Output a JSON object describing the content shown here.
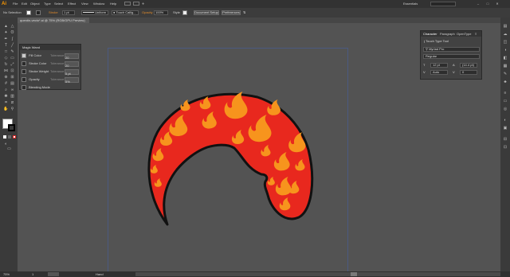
{
  "menubar": {
    "logo": "Ai",
    "items": [
      "File",
      "Edit",
      "Object",
      "Type",
      "Select",
      "Effect",
      "View",
      "Window",
      "Help"
    ],
    "workspace": "Essentials"
  },
  "controlbar": {
    "selection": "No Selection",
    "stroke_label": "Stroke",
    "stroke_weight": "1 pt",
    "stroke_profile": "Uniform",
    "brush": "Touch Callig...",
    "opacity_label": "Opacity",
    "opacity_value": "100%",
    "style_label": "Style",
    "doc_setup": "Document Setup",
    "preferences": "Preferences"
  },
  "document": {
    "tab_title": "quentin-vecto*.ai @ 75% (RGB/GPU Preview)"
  },
  "magic_wand_panel": {
    "title": "Magic Wand",
    "rows": [
      {
        "label": "Fill Color",
        "tolerance_label": "Tolerance",
        "value": "20",
        "checked": true
      },
      {
        "label": "Stroke Color",
        "tolerance_label": "Tolerance",
        "value": "20",
        "checked": false
      },
      {
        "label": "Stroke Weight",
        "tolerance_label": "Tolerance",
        "value": "5 pt",
        "checked": false
      },
      {
        "label": "Opacity",
        "tolerance_label": "Tolerance",
        "value": "5%",
        "checked": false
      },
      {
        "label": "Blending Mode",
        "tolerance_label": "",
        "value": "",
        "checked": false
      }
    ]
  },
  "character_panel": {
    "tabs": [
      "Character",
      "Paragraph",
      "OpenType"
    ],
    "touch_type": "Touch Type Tool",
    "font_family": "Myriad Pro",
    "font_style": "Regular",
    "size": "12 pt",
    "leading": "(14.4 pt)",
    "kerning": "Auto",
    "tracking": "0"
  },
  "status": {
    "zoom": "75%",
    "page": "1",
    "tool": "Hand"
  },
  "colors": {
    "fill": "#ffffff",
    "stroke": "#000000",
    "art_red": "#e8281e",
    "art_orange": "#f7941d",
    "accent": "#ff9a00"
  }
}
